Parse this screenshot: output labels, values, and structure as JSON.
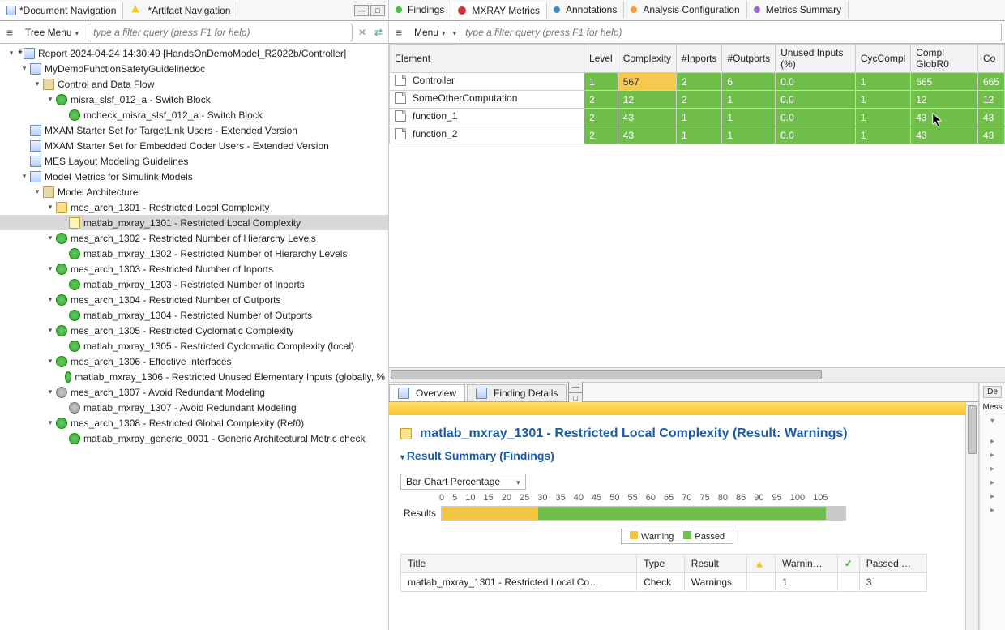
{
  "left": {
    "tabs": [
      {
        "label": "*Document Navigation",
        "active": true,
        "icon": "doc"
      },
      {
        "label": "*Artifact Navigation",
        "active": false,
        "icon": "warn"
      }
    ],
    "menu_label": "Tree Menu",
    "filter_placeholder": "type a filter query (press F1 for help)",
    "tree": [
      {
        "depth": 0,
        "exp": "-",
        "icon": "doc",
        "dirty": true,
        "label": "Report 2024-04-24 14:30:49 [HandsOnDemoModel_R2022b/Controller]"
      },
      {
        "depth": 1,
        "exp": "-",
        "icon": "doc",
        "label": "MyDemoFunctionSafetyGuidelinedoc"
      },
      {
        "depth": 2,
        "exp": "-",
        "icon": "folder",
        "label": "Control and Data Flow"
      },
      {
        "depth": 3,
        "exp": "-",
        "icon": "check-green",
        "label": "misra_slsf_012_a - Switch Block"
      },
      {
        "depth": 4,
        "exp": " ",
        "icon": "check-green",
        "label": "mcheck_misra_slsf_012_a - Switch Block"
      },
      {
        "depth": 1,
        "exp": " ",
        "icon": "doc",
        "label": "MXAM Starter Set for TargetLink Users - Extended Version"
      },
      {
        "depth": 1,
        "exp": " ",
        "icon": "doc",
        "label": "MXAM Starter Set for Embedded Coder Users - Extended Version"
      },
      {
        "depth": 1,
        "exp": " ",
        "icon": "doc",
        "label": "MES Layout Modeling Guidelines"
      },
      {
        "depth": 1,
        "exp": "-",
        "icon": "doc",
        "label": "Model Metrics for Simulink Models"
      },
      {
        "depth": 2,
        "exp": "-",
        "icon": "folder",
        "label": "Model Architecture"
      },
      {
        "depth": 3,
        "exp": "-",
        "icon": "yellow",
        "label": "mes_arch_1301 - Restricted Local Complexity"
      },
      {
        "depth": 4,
        "exp": " ",
        "icon": "yellow-sub",
        "label": "matlab_mxray_1301 - Restricted Local Complexity",
        "selected": true
      },
      {
        "depth": 3,
        "exp": "-",
        "icon": "check-green",
        "label": "mes_arch_1302 - Restricted Number of Hierarchy Levels"
      },
      {
        "depth": 4,
        "exp": " ",
        "icon": "check-green",
        "label": "matlab_mxray_1302 - Restricted Number of Hierarchy Levels"
      },
      {
        "depth": 3,
        "exp": "-",
        "icon": "check-green",
        "label": "mes_arch_1303 - Restricted Number of Inports"
      },
      {
        "depth": 4,
        "exp": " ",
        "icon": "check-green",
        "label": "matlab_mxray_1303 - Restricted Number of Inports"
      },
      {
        "depth": 3,
        "exp": "-",
        "icon": "check-green",
        "label": "mes_arch_1304 - Restricted Number of Outports"
      },
      {
        "depth": 4,
        "exp": " ",
        "icon": "check-green",
        "label": "matlab_mxray_1304 - Restricted Number of Outports"
      },
      {
        "depth": 3,
        "exp": "-",
        "icon": "check-green",
        "label": "mes_arch_1305 - Restricted Cyclomatic Complexity"
      },
      {
        "depth": 4,
        "exp": " ",
        "icon": "check-green",
        "label": "matlab_mxray_1305 - Restricted Cyclomatic Complexity (local)"
      },
      {
        "depth": 3,
        "exp": "-",
        "icon": "check-green",
        "label": "mes_arch_1306 - Effective Interfaces"
      },
      {
        "depth": 4,
        "exp": " ",
        "icon": "check-green",
        "label": "matlab_mxray_1306 - Restricted Unused Elementary Inputs (globally, %"
      },
      {
        "depth": 3,
        "exp": "-",
        "icon": "check-gray",
        "label": "mes_arch_1307 - Avoid Redundant Modeling"
      },
      {
        "depth": 4,
        "exp": " ",
        "icon": "check-gray",
        "label": "matlab_mxray_1307 - Avoid Redundant Modeling"
      },
      {
        "depth": 3,
        "exp": "-",
        "icon": "check-green",
        "label": "mes_arch_1308 - Restricted Global Complexity (Ref0)"
      },
      {
        "depth": 4,
        "exp": " ",
        "icon": "check-green",
        "label": "matlab_mxray_generic_0001 - Generic Architectural Metric check"
      }
    ]
  },
  "right": {
    "tabs": [
      {
        "label": "Findings",
        "icon": "green"
      },
      {
        "label": "MXRAY Metrics",
        "icon": "red",
        "active": true
      },
      {
        "label": "Annotations",
        "icon": "blue"
      },
      {
        "label": "Analysis Configuration",
        "icon": "orange"
      },
      {
        "label": "Metrics Summary",
        "icon": "purple"
      }
    ],
    "menu_label": "Menu",
    "filter_placeholder": "type a filter query (press F1 for help)",
    "table": {
      "headers": [
        "Element",
        "Level",
        "Complexity",
        "#Inports",
        "#Outports",
        "Unused Inputs (%)",
        "CycCompl",
        "Compl GlobR0",
        "Co"
      ],
      "rows": [
        {
          "name": "Controller",
          "cells": [
            {
              "v": "1",
              "c": "green"
            },
            {
              "v": "567",
              "c": "yellow"
            },
            {
              "v": "2",
              "c": "green"
            },
            {
              "v": "6",
              "c": "green"
            },
            {
              "v": "0.0",
              "c": "green"
            },
            {
              "v": "1",
              "c": "green"
            },
            {
              "v": "665",
              "c": "green"
            },
            {
              "v": "665",
              "c": "green"
            }
          ]
        },
        {
          "name": "SomeOtherComputation",
          "cells": [
            {
              "v": "2",
              "c": "green"
            },
            {
              "v": "12",
              "c": "green"
            },
            {
              "v": "2",
              "c": "green"
            },
            {
              "v": "1",
              "c": "green"
            },
            {
              "v": "0.0",
              "c": "green"
            },
            {
              "v": "1",
              "c": "green"
            },
            {
              "v": "12",
              "c": "green"
            },
            {
              "v": "12",
              "c": "green"
            }
          ]
        },
        {
          "name": "function_1",
          "cells": [
            {
              "v": "2",
              "c": "green"
            },
            {
              "v": "43",
              "c": "green"
            },
            {
              "v": "1",
              "c": "green"
            },
            {
              "v": "1",
              "c": "green"
            },
            {
              "v": "0.0",
              "c": "green"
            },
            {
              "v": "1",
              "c": "green"
            },
            {
              "v": "43",
              "c": "green"
            },
            {
              "v": "43",
              "c": "green"
            }
          ]
        },
        {
          "name": "function_2",
          "cells": [
            {
              "v": "2",
              "c": "green"
            },
            {
              "v": "43",
              "c": "green"
            },
            {
              "v": "1",
              "c": "green"
            },
            {
              "v": "1",
              "c": "green"
            },
            {
              "v": "0.0",
              "c": "green"
            },
            {
              "v": "1",
              "c": "green"
            },
            {
              "v": "43",
              "c": "green"
            },
            {
              "v": "43",
              "c": "green"
            }
          ]
        }
      ]
    }
  },
  "detail": {
    "tabs": [
      {
        "label": "Overview",
        "active": true
      },
      {
        "label": "Finding Details",
        "active": false
      }
    ],
    "side_tab": "De",
    "side_label": "Mess",
    "title": "matlab_mxray_1301 - Restricted Local Complexity (Result: Warnings)",
    "section": "Result Summary (Findings)",
    "combo": "Bar Chart Percentage",
    "bar_label": "Results",
    "legend": {
      "warn": "Warning",
      "pass": "Passed"
    },
    "result_headers": [
      "Title",
      "Type",
      "Result",
      "",
      "Warnin…",
      "",
      "Passed …"
    ],
    "result_row": {
      "title": "matlab_mxray_1301 - Restricted Local Co…",
      "type": "Check",
      "result": "Warnings",
      "warn": "1",
      "pass": "3"
    }
  },
  "chart_data": {
    "type": "bar",
    "orientation": "horizontal",
    "stacked": true,
    "title": "",
    "xlabel": "Percentage",
    "ylabel": "",
    "categories": [
      "Results"
    ],
    "xlim": [
      0,
      105
    ],
    "xticks": [
      0,
      5,
      10,
      15,
      20,
      25,
      30,
      35,
      40,
      45,
      50,
      55,
      60,
      65,
      70,
      75,
      80,
      85,
      90,
      95,
      100,
      105
    ],
    "series": [
      {
        "name": "Warning",
        "color": "#f4c542",
        "values": [
          25
        ]
      },
      {
        "name": "Passed",
        "color": "#6fbf4a",
        "values": [
          75
        ]
      }
    ],
    "extra_gray_tail_pct": 5
  }
}
